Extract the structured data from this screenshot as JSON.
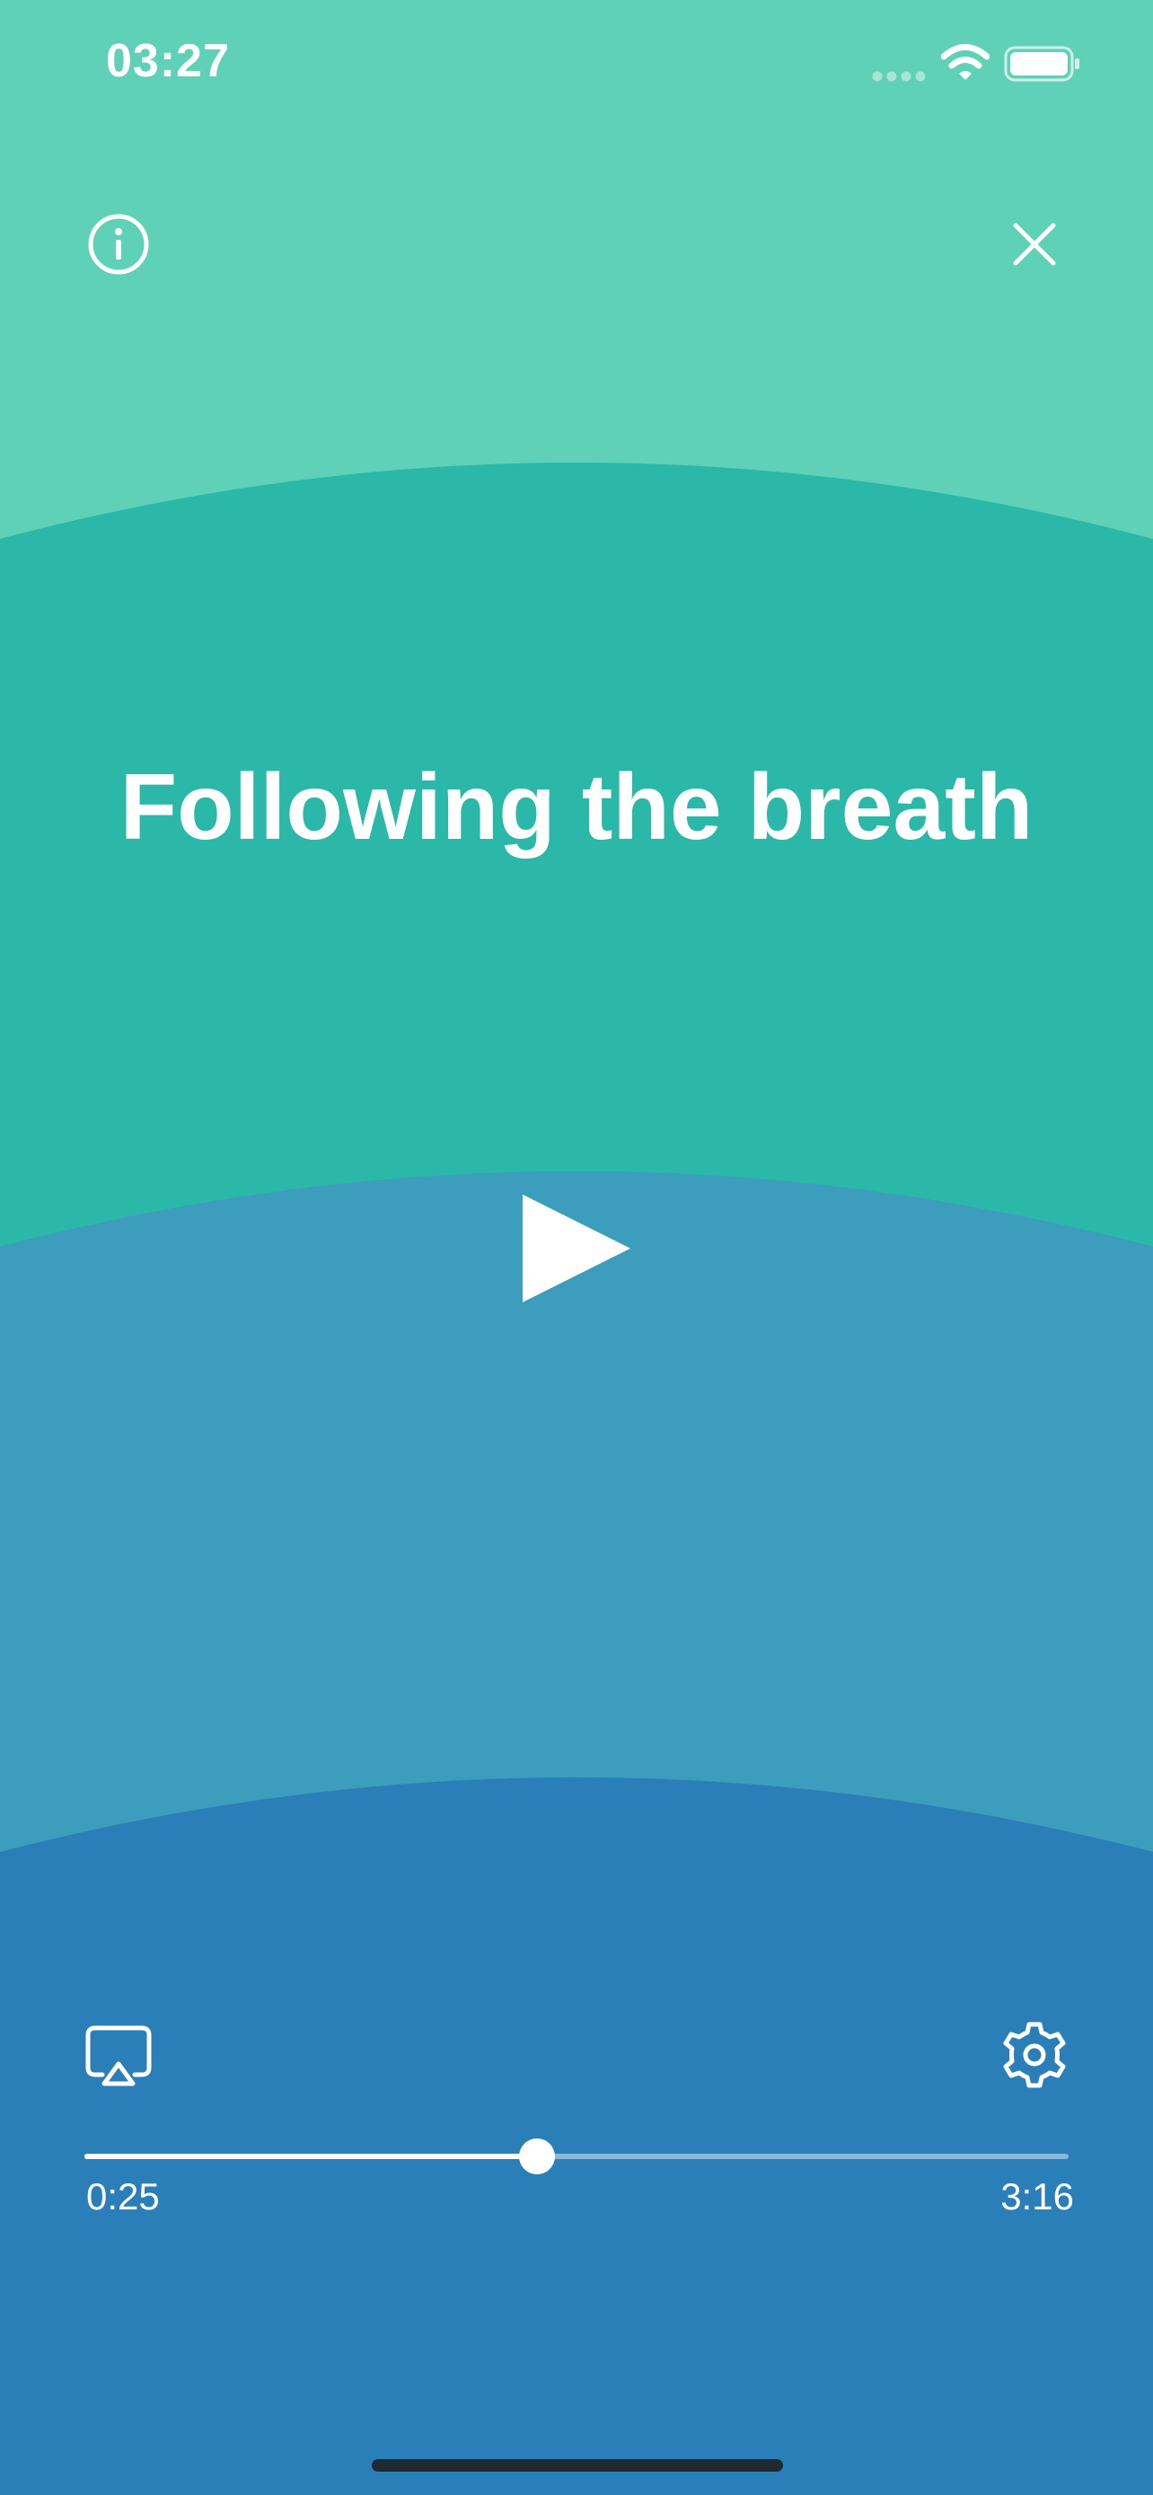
{
  "status_bar": {
    "time": "03:27",
    "icons": [
      "signal-dots-icon",
      "wifi-icon",
      "battery-icon"
    ]
  },
  "header": {
    "info_icon": "info-icon",
    "close_icon": "close-icon"
  },
  "session": {
    "title": "Following the breath",
    "play_icon": "play-icon"
  },
  "controls": {
    "airplay_icon": "airplay-icon",
    "settings_icon": "gear-icon"
  },
  "progress": {
    "elapsed": "0:25",
    "duration": "3:16",
    "fraction": 0.46
  },
  "colors": {
    "band_1": "#5fd1b7",
    "band_2": "#2bb8a9",
    "band_3": "#3c9dbd",
    "band_4": "#2b7fb8",
    "foreground": "#ffffff"
  }
}
